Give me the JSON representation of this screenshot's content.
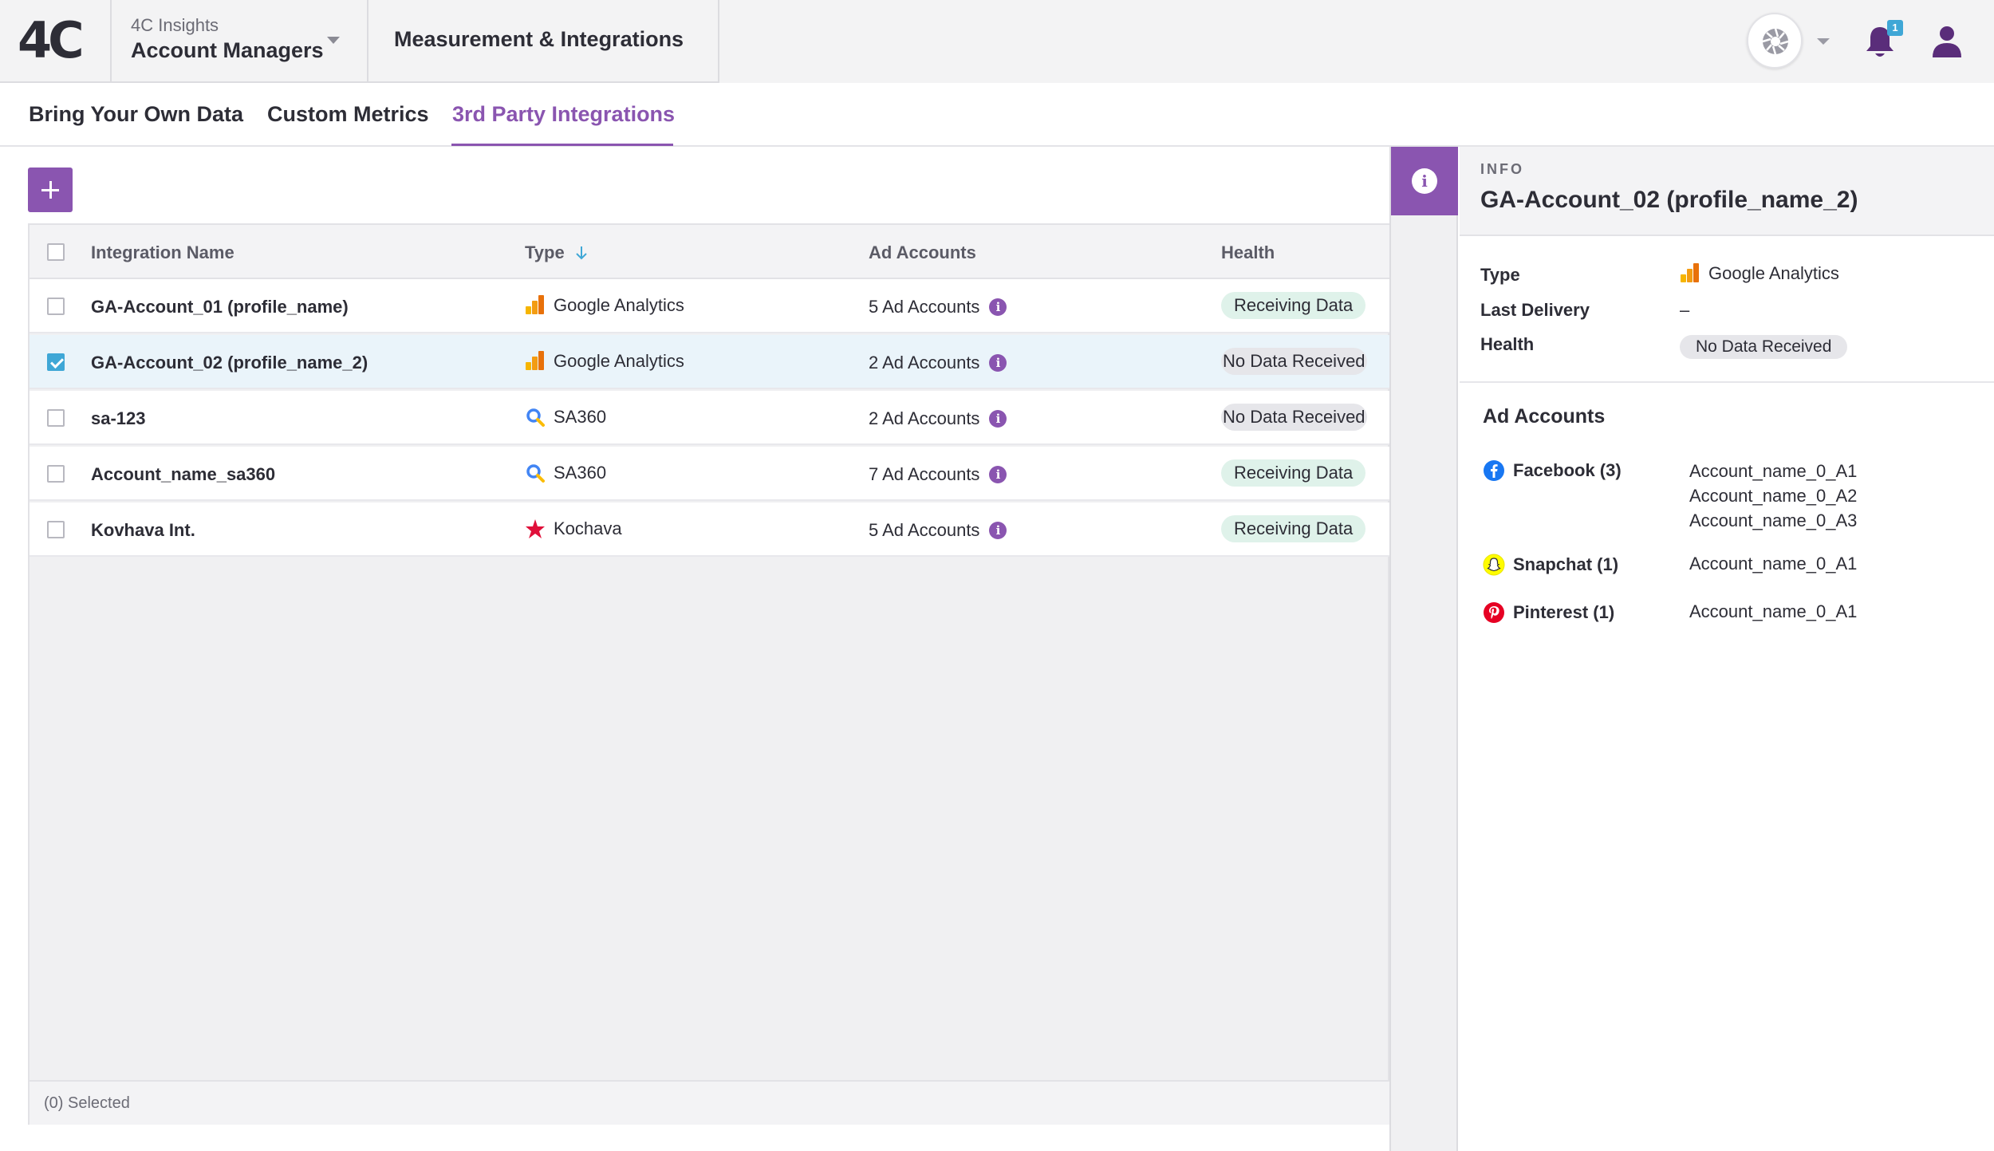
{
  "brand": {
    "logo_text": "4C",
    "accent": "#8a55b0",
    "checkbox_color": "#3fa7d6"
  },
  "header": {
    "org_label": "4C Insights",
    "account_label": "Account Managers",
    "section_title": "Measurement & Integrations",
    "notification_count": "1"
  },
  "tabs": [
    {
      "label": "Bring Your Own Data",
      "active": false
    },
    {
      "label": "Custom Metrics",
      "active": false
    },
    {
      "label": "3rd Party Integrations",
      "active": true
    }
  ],
  "table": {
    "columns": [
      "Integration Name",
      "Type",
      "Ad Accounts",
      "Health"
    ],
    "sort_column": "Type",
    "rows": [
      {
        "name": "GA-Account_01 (profile_name)",
        "type": "Google Analytics",
        "type_icon": "google-analytics-icon",
        "ad_accounts": "5 Ad Accounts",
        "health": "Receiving Data",
        "checked": false
      },
      {
        "name": "GA-Account_02 (profile_name_2)",
        "type": "Google Analytics",
        "type_icon": "google-analytics-icon",
        "ad_accounts": "2 Ad Accounts",
        "health": "No Data Received",
        "checked": true
      },
      {
        "name": "sa-123",
        "type": "SA360",
        "type_icon": "sa360-search-icon",
        "ad_accounts": "2 Ad Accounts",
        "health": "No Data Received",
        "checked": false
      },
      {
        "name": "Account_name_sa360",
        "type": "SA360",
        "type_icon": "sa360-search-icon",
        "ad_accounts": "7 Ad Accounts",
        "health": "Receiving Data",
        "checked": false
      },
      {
        "name": "Kovhava Int.",
        "type": "Kochava",
        "type_icon": "kochava-star-icon",
        "ad_accounts": "5 Ad Accounts",
        "health": "Receiving Data",
        "checked": false
      }
    ],
    "footer": "(0) Selected"
  },
  "panel": {
    "kicker": "INFO",
    "title": "GA-Account_02 (profile_name_2)",
    "type_label": "Type",
    "type_value": "Google Analytics",
    "last_delivery_label": "Last Delivery",
    "last_delivery_value": "–",
    "health_label": "Health",
    "health_value": "No Data Received",
    "ad_accounts_heading": "Ad Accounts",
    "networks": [
      {
        "name": "Facebook (3)",
        "icon": "facebook-icon",
        "color": "#1877f2",
        "accounts": [
          "Account_name_0_A1",
          "Account_name_0_A2",
          "Account_name_0_A3"
        ]
      },
      {
        "name": "Snapchat (1)",
        "icon": "snapchat-icon",
        "color": "#fffc00",
        "accounts": [
          "Account_name_0_A1"
        ]
      },
      {
        "name": "Pinterest (1)",
        "icon": "pinterest-icon",
        "color": "#e60023",
        "accounts": [
          "Account_name_0_A1"
        ]
      }
    ]
  }
}
